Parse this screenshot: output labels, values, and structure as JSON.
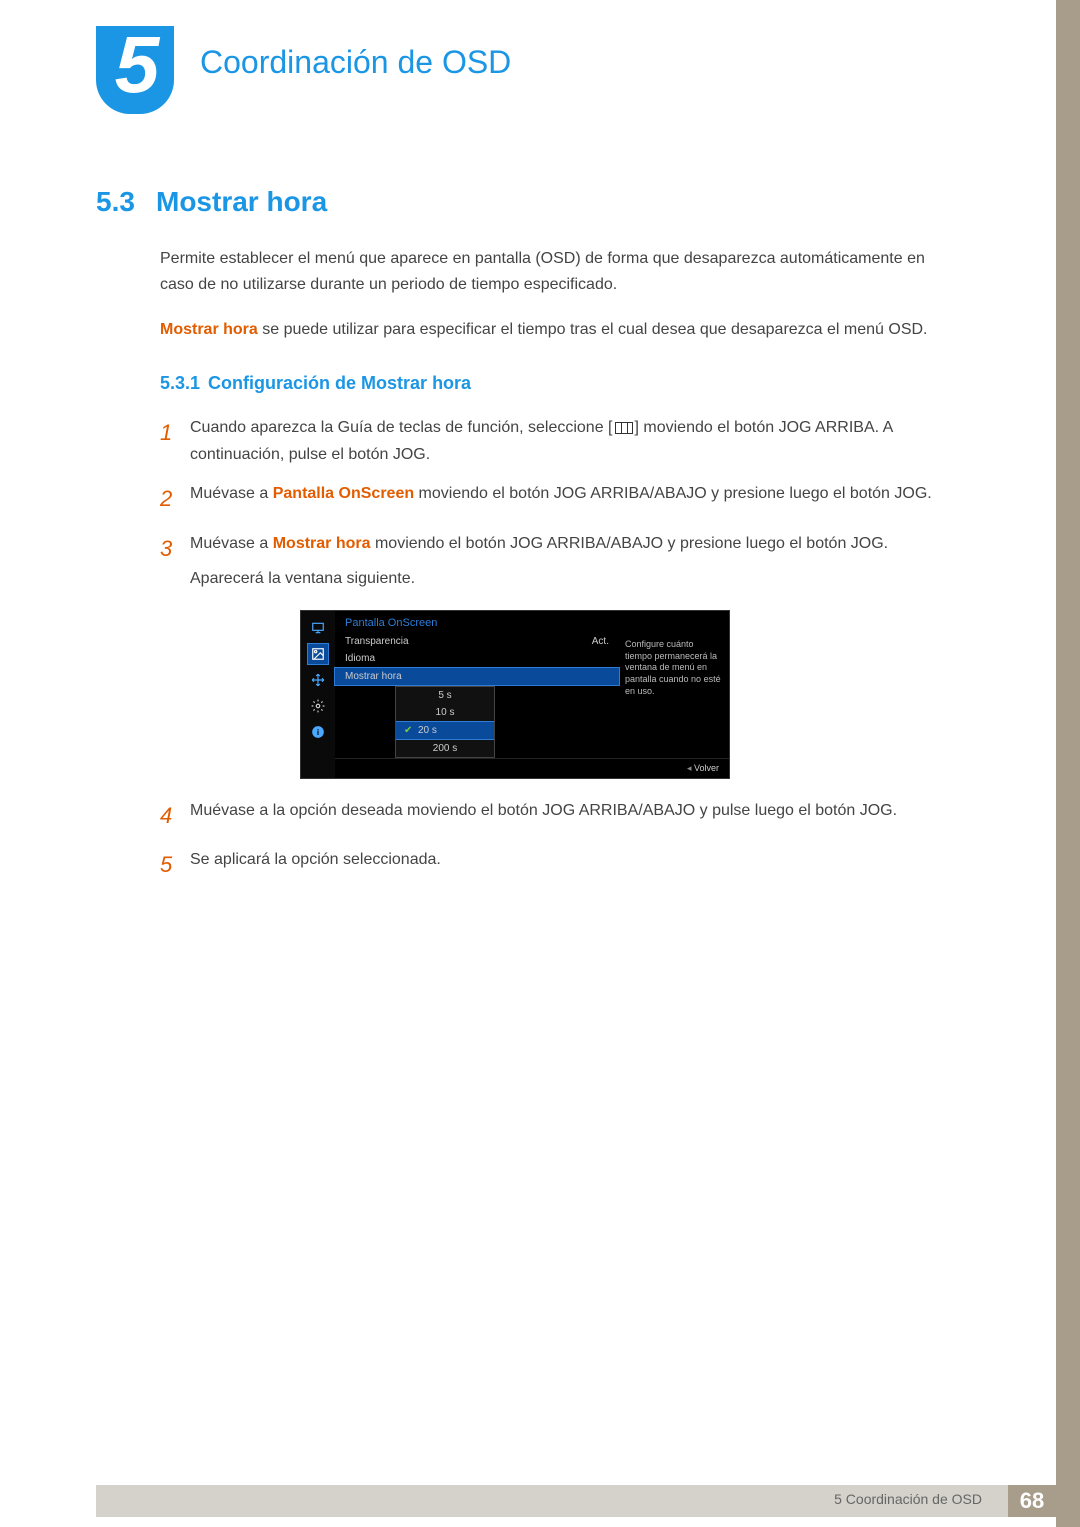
{
  "chapter": {
    "number": "5",
    "title": "Coordinación de OSD"
  },
  "section": {
    "number": "5.3",
    "title": "Mostrar hora"
  },
  "intro": {
    "p1": "Permite establecer el menú que aparece en pantalla (OSD) de forma que desaparezca automáticamente en caso de no utilizarse durante un periodo de tiempo especificado.",
    "p2_highlight": "Mostrar hora",
    "p2_rest": " se puede utilizar para especificar el tiempo tras el cual desea que desaparezca el menú OSD."
  },
  "subsection": {
    "number": "5.3.1",
    "title": "Configuración de Mostrar hora"
  },
  "steps": [
    {
      "num": "1",
      "pre": "Cuando aparezca la Guía de teclas de función, seleccione [",
      "post": "] moviendo el botón JOG ARRIBA. A continuación, pulse el botón JOG."
    },
    {
      "num": "2",
      "pre": "Muévase a ",
      "hl": "Pantalla OnScreen",
      "post": " moviendo el botón JOG ARRIBA/ABAJO y presione luego el botón JOG."
    },
    {
      "num": "3",
      "pre": "Muévase a ",
      "hl": "Mostrar hora",
      "post": " moviendo el botón JOG ARRIBA/ABAJO y presione luego el botón JOG.",
      "after": "Aparecerá la ventana siguiente."
    },
    {
      "num": "4",
      "text": "Muévase a la opción deseada moviendo el botón JOG ARRIBA/ABAJO y pulse luego el botón JOG."
    },
    {
      "num": "5",
      "text": "Se aplicará la opción seleccionada."
    }
  ],
  "osd": {
    "header": "Pantalla OnScreen",
    "rows": [
      {
        "label": "Transparencia",
        "value": "Act."
      },
      {
        "label": "Idioma",
        "value": ""
      },
      {
        "label": "Mostrar hora",
        "value": "",
        "selected": true
      }
    ],
    "options": [
      "5 s",
      "10 s",
      "20 s",
      "200 s"
    ],
    "selected_option": "20 s",
    "hint": "Configure cuánto tiempo permanecerá la ventana de menú en pantalla cuando no esté en uso.",
    "back": "Volver"
  },
  "footer": {
    "label": "5 Coordinación de OSD",
    "page": "68"
  }
}
